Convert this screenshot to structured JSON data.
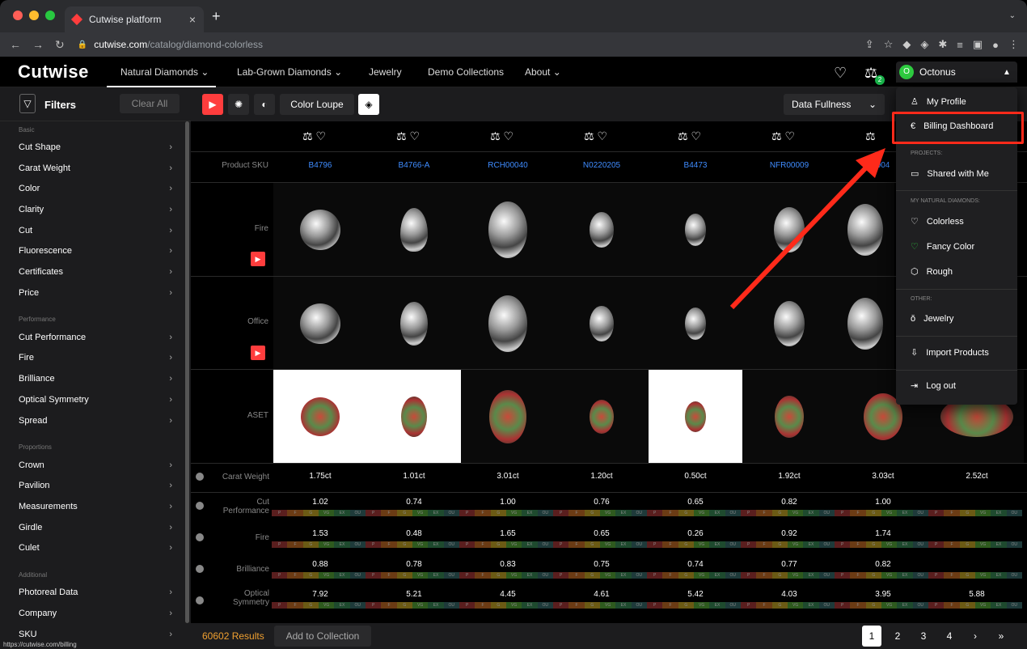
{
  "browser": {
    "tab_title": "Cutwise platform",
    "url_host": "cutwise.com",
    "url_path": "/catalog/diamond-colorless",
    "status_url": "https://cutwise.com/billing"
  },
  "app": {
    "logo": "Cutwise",
    "nav": [
      "Natural Diamonds",
      "Lab-Grown Diamonds",
      "Jewelry",
      "Demo Collections",
      "About"
    ],
    "compare_badge": "2",
    "user_initial": "O",
    "user_name": "Octonus"
  },
  "sidebar": {
    "filters_label": "Filters",
    "clear_all": "Clear All",
    "sections": [
      {
        "title": "Basic",
        "items": [
          "Cut Shape",
          "Carat Weight",
          "Color",
          "Clarity",
          "Cut",
          "Fluorescence",
          "Certificates",
          "Price"
        ]
      },
      {
        "title": "Performance",
        "items": [
          "Cut Performance",
          "Fire",
          "Brilliance",
          "Optical Symmetry",
          "Spread"
        ]
      },
      {
        "title": "Proportions",
        "items": [
          "Crown",
          "Pavilion",
          "Measurements",
          "Girdle",
          "Culet"
        ]
      },
      {
        "title": "Additional",
        "items": [
          "Photoreal Data",
          "Company",
          "SKU"
        ]
      }
    ]
  },
  "toolbar": {
    "color_loupe": "Color Loupe",
    "data_fullness": "Data Fullness"
  },
  "grid": {
    "row_labels": {
      "sku": "Product SKU",
      "fire_img": "Fire",
      "office": "Office",
      "aset": "ASET",
      "carat": "Carat Weight",
      "cut_perf_1": "Cut",
      "cut_perf_2": "Performance",
      "fire": "Fire",
      "brilliance": "Brilliance",
      "optsym_1": "Optical",
      "optsym_2": "Symmetry"
    },
    "skus": [
      "B4796",
      "B4766-A",
      "RCH00040",
      "N0220205",
      "B4473",
      "NFR00009",
      "004"
    ],
    "carat": [
      "1.75ct",
      "1.01ct",
      "3.01ct",
      "1.20ct",
      "0.50ct",
      "1.92ct",
      "3.03ct",
      "2.52ct"
    ],
    "cut_perf": [
      "1.02",
      "0.74",
      "1.00",
      "0.76",
      "0.65",
      "0.82",
      "1.00",
      ""
    ],
    "fire": [
      "1.53",
      "0.48",
      "1.65",
      "0.65",
      "0.26",
      "0.92",
      "1.74",
      ""
    ],
    "brilliance": [
      "0.88",
      "0.78",
      "0.83",
      "0.75",
      "0.74",
      "0.77",
      "0.82",
      ""
    ],
    "opt_sym": [
      "7.92",
      "5.21",
      "4.45",
      "4.61",
      "5.42",
      "4.03",
      "3.95",
      "5.88"
    ],
    "scale_labels": [
      "P",
      "F",
      "G",
      "VG",
      "EX",
      "OU"
    ]
  },
  "bottom": {
    "results": "60602 Results",
    "add_to_collection": "Add to Collection",
    "pages": [
      "1",
      "2",
      "3",
      "4",
      "›",
      "»"
    ]
  },
  "dropdown": {
    "my_profile": "My Profile",
    "billing": "Billing Dashboard",
    "projects_title": "PROJECTS:",
    "shared": "Shared with Me",
    "natural_title": "MY NATURAL DIAMONDS:",
    "colorless": "Colorless",
    "fancy": "Fancy Color",
    "rough": "Rough",
    "other_title": "OTHER:",
    "jewelry": "Jewelry",
    "import": "Import Products",
    "logout": "Log out"
  },
  "colors": {
    "accent_red": "#ff3d3d",
    "link_blue": "#3f8cff",
    "results_orange": "#f0a030",
    "annotation_red": "#ff2a1a"
  }
}
